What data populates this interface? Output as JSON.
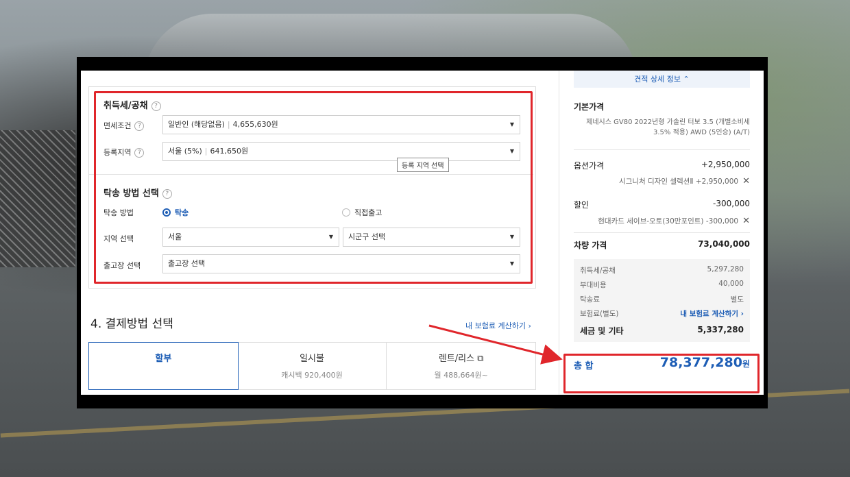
{
  "acquisition_tax": {
    "title": "취득세/공채",
    "exemption_label": "면세조건",
    "exemption_value": "일반인 (해당없음)",
    "exemption_amount": "4,655,630원",
    "region_label": "등록지역",
    "region_value": "서울 (5%)",
    "region_amount": "641,650원",
    "tooltip": "등록 지역 선택"
  },
  "delivery": {
    "title": "탁송 방법 선택",
    "method_label": "탁송 방법",
    "option_delivery": "탁송",
    "option_pickup": "직접출고",
    "region_label": "지역 선택",
    "region_value": "서울",
    "district_value": "시군구 선택",
    "center_label": "출고장 선택",
    "center_value": "출고장 선택"
  },
  "payment": {
    "title": "4. 결제방법 선택",
    "insurance_link": "내 보험료 계산하기 ›",
    "tabs": [
      {
        "label": "할부",
        "sub": ""
      },
      {
        "label": "일시불",
        "sub": "캐시백 920,400원"
      },
      {
        "label": "렌트/리스 ⧉",
        "sub": "월 488,664원~"
      }
    ]
  },
  "summary": {
    "detail_toggle": "견적 상세 정보 ⌃",
    "base_price_label": "기본가격",
    "base_price_desc": "제네시스 GV80 2022년형 가솔린 터보 3.5 (개별소비세 3.5% 적용) AWD (5인승) (A/T)",
    "option_label": "옵션가격",
    "option_value": "+2,950,000",
    "option_item": "시그니처 디자인 셀렉션Ⅱ",
    "option_item_value": "+2,950,000",
    "discount_label": "할인",
    "discount_value": "-300,000",
    "discount_item": "현대카드 세이브-오토(30만포인트)",
    "discount_item_value": "-300,000",
    "remove_icon": "✕",
    "vehicle_price_label": "차량 가격",
    "vehicle_price_value": "73,040,000",
    "tax_rows": [
      {
        "label": "취득세/공채",
        "value": "5,297,280"
      },
      {
        "label": "부대비용",
        "value": "40,000"
      },
      {
        "label": "탁송료",
        "value": "별도"
      },
      {
        "label": "보험료(별도)",
        "value": "내 보험료 계산하기 ›"
      }
    ],
    "tax_total_label": "세금 및 기타",
    "tax_total_value": "5,337,280",
    "total_label": "총 합",
    "total_value": "78,377,280",
    "total_unit": "원"
  },
  "colors": {
    "accent": "#1d5db5",
    "highlight": "#e0262b"
  }
}
